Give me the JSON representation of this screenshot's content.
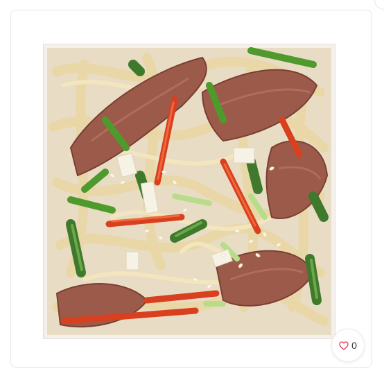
{
  "product": {
    "image_alt": "",
    "likes_count": "0"
  },
  "icons": {
    "like": "heart-outline-icon",
    "corner": "circle-icon"
  },
  "colors": {
    "heart": "#e0405a",
    "card_border": "#e6e6e6"
  }
}
